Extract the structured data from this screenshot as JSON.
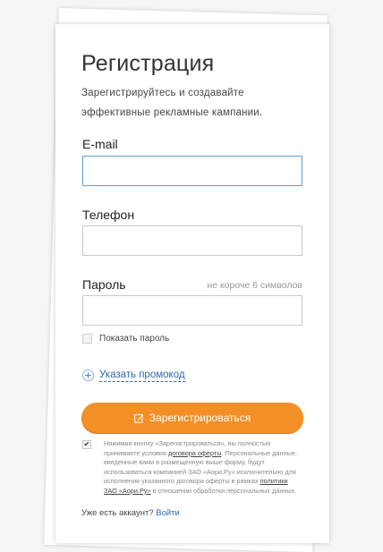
{
  "form": {
    "title": "Регистрация",
    "subtitle": "Зарегистрируйтесь и создавайте эффективные рекламные кампании.",
    "email_label": "E-mail",
    "email_value": "",
    "phone_label": "Телефон",
    "phone_value": "",
    "password_label": "Пароль",
    "password_hint": "не короче 6 символов",
    "password_value": "",
    "show_password_label": "Показать пароль",
    "show_password_checked": false,
    "promo_link": "Указать промокод",
    "submit_label": "Зарегистрироваться",
    "agree_checked": true,
    "agree_text_1": "Нажимая кнопку «Зарегистрироваться», вы полностью принимаете условия ",
    "agree_link_1": "договора оферты",
    "agree_text_2": ". Персональные данные, введенные вами в размещенную выше форму, будут использоваться компанией ЗАО «Аори.Ру» исключительно для исполнения указанного договора оферты в рамках ",
    "agree_link_2": "политики ЗАО «Аори.Ру»",
    "agree_text_3": " в отношении обработки персональных данных.",
    "account_question": "Уже есть аккаунт?",
    "login_link": "Войти"
  },
  "icons": {
    "promo": "plus-circle-icon",
    "submit": "edit-icon",
    "agree": "checkmark-icon"
  },
  "colors": {
    "accent": "#f28f26",
    "link": "#2f6aa8",
    "active_border": "#5aa0d6"
  }
}
